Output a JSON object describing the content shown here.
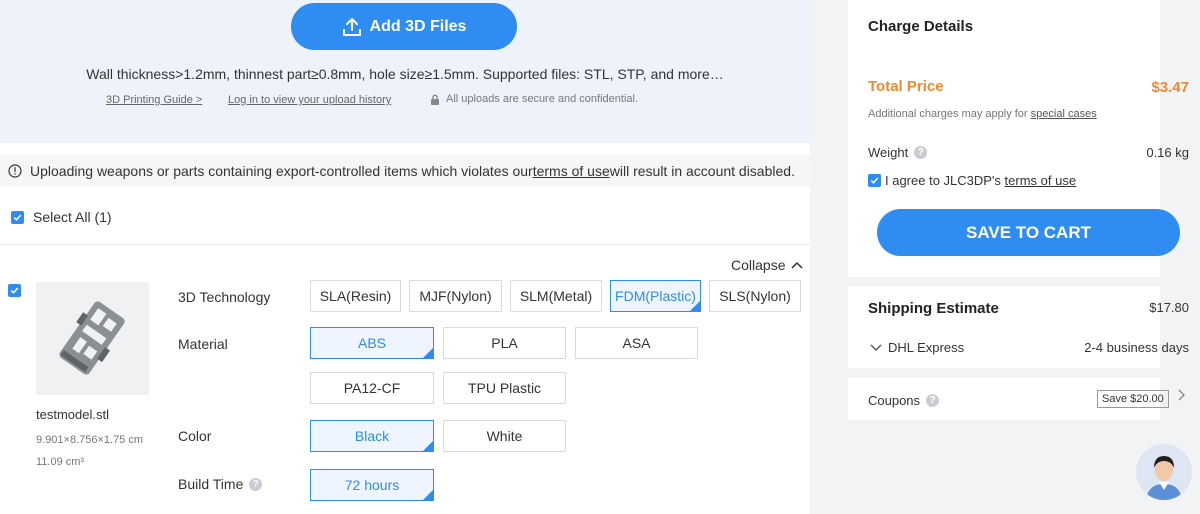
{
  "upload": {
    "add_button": "Add 3D Files",
    "hint": "Wall thickness>1.2mm, thinnest part≥0.8mm, hole size≥1.5mm. Supported files: STL, STP, and more…",
    "guide_link": "3D Printing Guide >",
    "history_link": "Log in to view your upload history",
    "secure_note": "All uploads are secure and confidential."
  },
  "warning": {
    "before": "Uploading weapons or parts containing export-controlled items which violates our ",
    "link": "terms of use ",
    "after": "will result in account disabled."
  },
  "select_all": "Select All (1)",
  "collapse": "Collapse",
  "file": {
    "name": "testmodel.stl",
    "dims": "9.901×8.756×1.75 cm",
    "volume": "11.09 cm³"
  },
  "options": {
    "technology": {
      "label": "3D Technology",
      "items": [
        "SLA(Resin)",
        "MJF(Nylon)",
        "SLM(Metal)",
        "FDM(Plastic)",
        "SLS(Nylon)"
      ],
      "selected": "FDM(Plastic)"
    },
    "material": {
      "label": "Material",
      "items": [
        "ABS",
        "PLA",
        "ASA",
        "PA12-CF",
        "TPU Plastic"
      ],
      "selected": "ABS"
    },
    "color": {
      "label": "Color",
      "items": [
        "Black",
        "White"
      ],
      "selected": "Black"
    },
    "build_time": {
      "label": "Build Time",
      "items": [
        "72 hours"
      ],
      "selected": "72 hours"
    }
  },
  "charge": {
    "title": "Charge Details",
    "total_label": "Total Price",
    "total_value": "$3.47",
    "additional_before": "Additional charges may apply for ",
    "additional_link": "special cases",
    "weight_label": "Weight",
    "weight_value": "0.16 kg",
    "agree_before": "I agree to JLC3DP's ",
    "agree_link": "terms of use",
    "save_button": "SAVE TO CART"
  },
  "shipping": {
    "title": "Shipping Estimate",
    "value": "$17.80",
    "method": "DHL Express",
    "time": "2-4 business days"
  },
  "coupons": {
    "label": "Coupons",
    "tag": "Save $20.00"
  },
  "colors": {
    "accent": "#2f8cf0",
    "price": "#f0892d"
  }
}
